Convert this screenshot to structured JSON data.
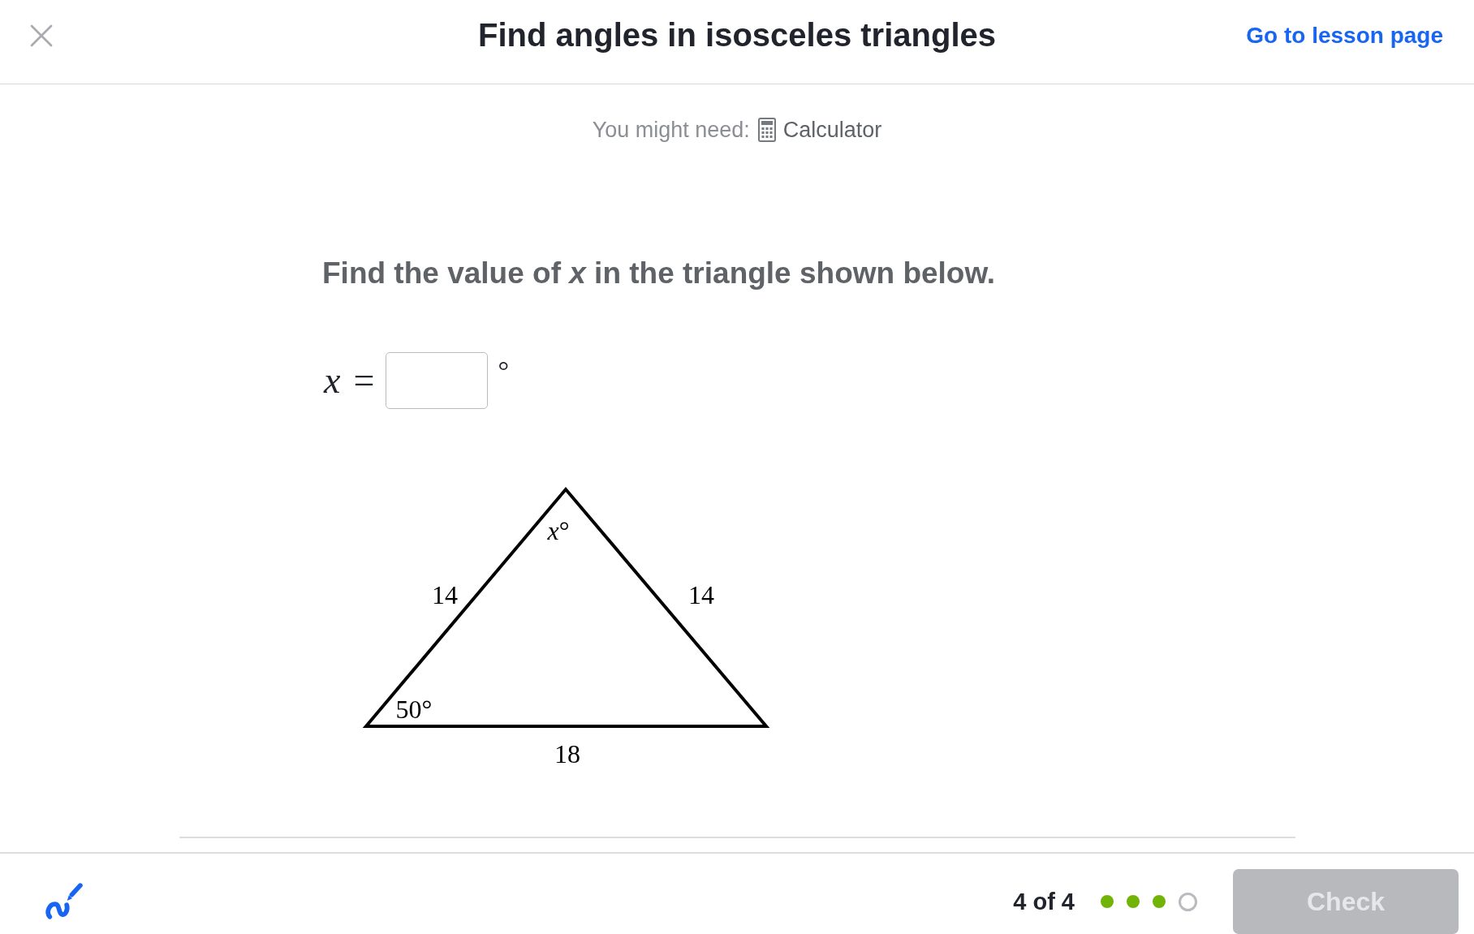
{
  "header": {
    "title": "Find angles in isosceles triangles",
    "lesson_link": "Go to lesson page"
  },
  "tools_hint": {
    "label": "You might need:",
    "tool": "Calculator"
  },
  "question": {
    "prompt": "Find the value of *x* in the triangle shown below."
  },
  "answer": {
    "variable": "x",
    "relation": "=",
    "unit": "°"
  },
  "triangle": {
    "apex_angle": "*x*°",
    "left_side": "14",
    "right_side": "14",
    "base_left_angle": "50°",
    "base": "18"
  },
  "footer": {
    "progress": "4 of 4",
    "steps": [
      {
        "done": true
      },
      {
        "done": true
      },
      {
        "done": true
      },
      {
        "done": false
      }
    ],
    "check_button": {
      "label": "Check",
      "disabled": true
    }
  }
}
